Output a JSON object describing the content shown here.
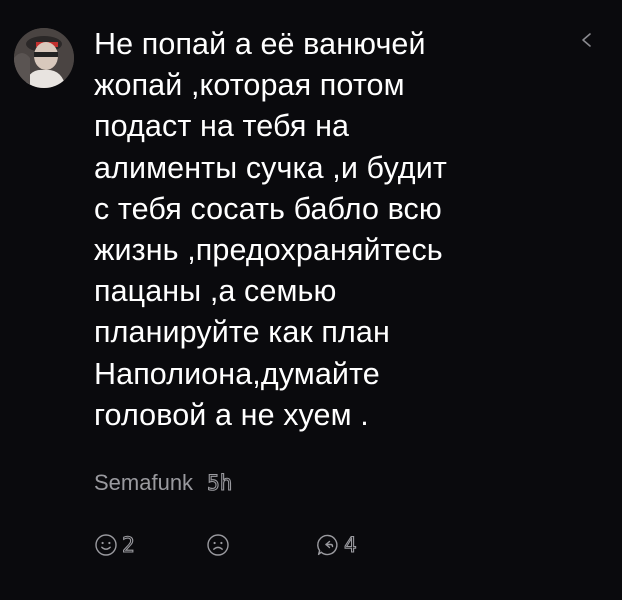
{
  "comment": {
    "text": "Не попай а её ванючей\nжопай ,которая потом\nподаст на тебя на\nалименты сучка ,и будит\nс тебя сосать бабло всю\nжизнь ,предохраняйтесь\nпацаны ,а семью\nпланируйте как план\nНаполиона,думайте\nголовой а не хуем .",
    "author": "Semafunk",
    "time": "5h"
  },
  "reactions": {
    "like_count": "2",
    "reply_count": "4"
  },
  "icons": {
    "avatar": "user-avatar-photo",
    "share": "share-arrow-icon",
    "like": "smiley-icon",
    "dislike": "smiley-icon",
    "reply": "reply-bubble-icon"
  },
  "colors": {
    "background": "#0a0a0d",
    "text": "#ffffff",
    "muted": "#9a9a9f"
  }
}
